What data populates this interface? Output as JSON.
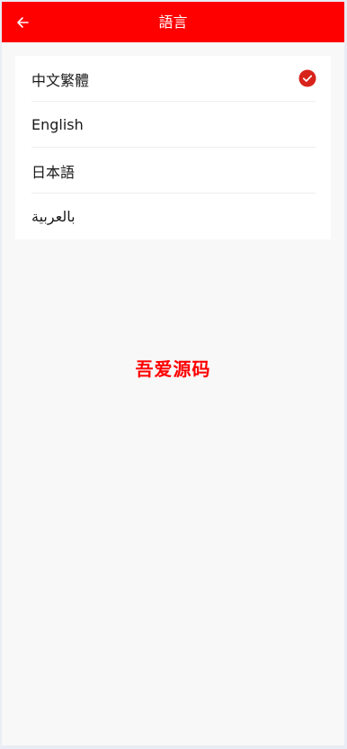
{
  "header": {
    "title": "語言",
    "back_icon": "arrow-left-icon",
    "background_color": "#ff0000"
  },
  "languages": [
    {
      "label": "中文繁體",
      "selected": true
    },
    {
      "label": "English",
      "selected": false
    },
    {
      "label": "日本語",
      "selected": false
    },
    {
      "label": "بالعربية",
      "selected": false
    }
  ],
  "check_icon": {
    "name": "check-circle-icon",
    "color": "#d8231b"
  },
  "watermark": {
    "text": "吾爱源码",
    "color": "#ff0000"
  }
}
